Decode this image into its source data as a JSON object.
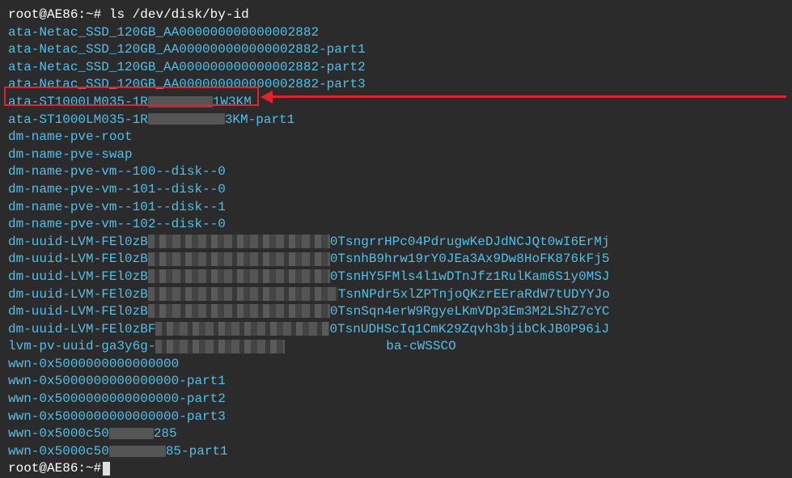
{
  "prompt1": {
    "user_host": "root@AE86",
    "path": "~",
    "hash": "#",
    "command": "ls /dev/disk/by-id"
  },
  "lines": {
    "l1": "ata-Netac_SSD_120GB_AA000000000000002882",
    "l2": "ata-Netac_SSD_120GB_AA000000000000002882-part1",
    "l3": "ata-Netac_SSD_120GB_AA000000000000002882-part2",
    "l4": "ata-Netac_SSD_120GB_AA000000000000002882-part3",
    "l5a": "ata-ST1000LM035-1R",
    "l5b": "1W3KM",
    "l6a": "ata-ST1000LM035-1R",
    "l6b": "3KM-part1",
    "l7": "dm-name-pve-root",
    "l8": "dm-name-pve-swap",
    "l9": "dm-name-pve-vm--100--disk--0",
    "l10": "dm-name-pve-vm--101--disk--0",
    "l11": "dm-name-pve-vm--101--disk--1",
    "l12": "dm-name-pve-vm--102--disk--0",
    "l13a": "dm-uuid-LVM-FEl0zB",
    "l13b": "0TsngrrHPc04PdrugwKeDJdNCJQt0wI6ErMj",
    "l14a": "dm-uuid-LVM-FEl0zB",
    "l14b": "0TsnhB9hrw19rY0JEa3Ax9Dw8HoFK876kFj5",
    "l15a": "dm-uuid-LVM-FEl0zB",
    "l15b": "0TsnHY5FMls4l1wDTnJfz1RulKam6S1y0MSJ",
    "l16a": "dm-uuid-LVM-FEl0zB",
    "l16b": "TsnNPdr5xlZPTnjoQKzrEEraRdW7tUDYYJo",
    "l17a": "dm-uuid-LVM-FEl0zB",
    "l17b": "0TsnSqn4erW9RgyeLKmVDp3Em3M2LShZ7cYC",
    "l18a": "dm-uuid-LVM-FEl0zBF",
    "l18b": "0TsnUDHScIq1CmK29Zqvh3bjibCkJB0P96iJ",
    "l19a": "lvm-pv-uuid-ga3y6g-",
    "l19b": "ba-cWSSCO",
    "l20": "wwn-0x5000000000000000",
    "l21": "wwn-0x5000000000000000-part1",
    "l22": "wwn-0x5000000000000000-part2",
    "l23": "wwn-0x5000000000000000-part3",
    "l24a": "wwn-0x5000c50",
    "l24b": "285",
    "l25a": "wwn-0x5000c50",
    "l25b": "85-part1"
  },
  "prompt2": {
    "user_host": "root@AE86",
    "path": "~",
    "hash": "#"
  }
}
